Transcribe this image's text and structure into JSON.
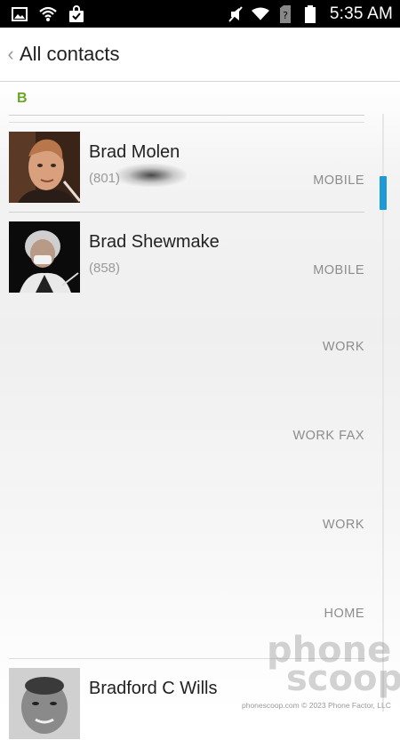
{
  "status_bar": {
    "time": "5:35 AM",
    "left_icons": [
      "gallery-icon",
      "wifi-hotspot-icon",
      "shopping-bag-check-icon"
    ],
    "right_icons": [
      "mute-icon",
      "wifi-icon",
      "no-sim-icon",
      "battery-icon"
    ]
  },
  "header": {
    "back_glyph": "‹",
    "title": "All contacts"
  },
  "section": {
    "letter": "B"
  },
  "contacts": [
    {
      "name": "Brad Molen",
      "number": "(801)",
      "label": "MOBILE"
    },
    {
      "name": "Brad Shewmake",
      "number": "(858)",
      "label": "MOBILE"
    },
    {
      "name": "Bradford C Wills",
      "number": "",
      "label": ""
    }
  ],
  "floating_labels": [
    "WORK",
    "WORK FAX",
    "WORK",
    "HOME"
  ],
  "watermark": {
    "line1": "phone",
    "line2": "scoop",
    "footer": "phonescoop.com  © 2023 Phone Factor, LLC"
  },
  "colors": {
    "accent_green": "#6aa626",
    "scroll_thumb": "#1e9ad6",
    "status_bar_bg": "#000000"
  }
}
